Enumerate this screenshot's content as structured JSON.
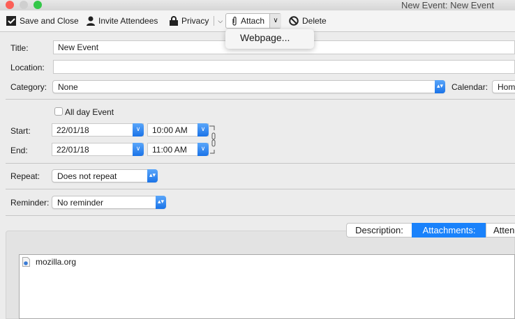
{
  "window": {
    "title": "New Event: New Event"
  },
  "toolbar": {
    "save_close": "Save and Close",
    "invite": "Invite Attendees",
    "privacy": "Privacy",
    "attach": "Attach",
    "delete": "Delete"
  },
  "attach_menu": {
    "items": [
      "Webpage..."
    ]
  },
  "form": {
    "title_label": "Title:",
    "title_value": "New Event",
    "location_label": "Location:",
    "location_value": "",
    "category_label": "Category:",
    "category_value": "None",
    "calendar_label": "Calendar:",
    "calendar_value": "Home",
    "allday_label": "All day Event",
    "allday_checked": false,
    "start_label": "Start:",
    "start_date": "22/01/18",
    "start_time": "10:00 AM",
    "end_label": "End:",
    "end_date": "22/01/18",
    "end_time": "11:00 AM",
    "repeat_label": "Repeat:",
    "repeat_value": "Does not repeat",
    "reminder_label": "Reminder:",
    "reminder_value": "No reminder"
  },
  "tabs": [
    {
      "label": "Description:"
    },
    {
      "label": "Attachments:",
      "selected": true
    },
    {
      "label": "Atten"
    }
  ],
  "attachments": [
    {
      "name": "mozilla.org"
    }
  ],
  "colors": {
    "accent": "#1a73e8"
  }
}
